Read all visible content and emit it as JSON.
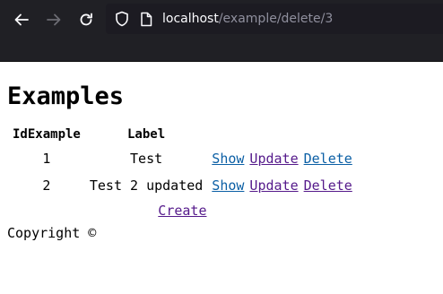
{
  "browser": {
    "url_host": "localhost",
    "url_path": "/example/delete/3",
    "icons": [
      "back-arrow-icon",
      "forward-arrow-icon",
      "reload-icon",
      "shield-icon",
      "page-icon"
    ]
  },
  "page": {
    "title": "Examples",
    "table": {
      "headers": [
        "IdExample",
        "Label"
      ],
      "rows": [
        {
          "id": "1",
          "label": "Test",
          "show": "Show",
          "update": "Update",
          "delete": "Delete"
        },
        {
          "id": "2",
          "label": "Test 2 updated",
          "show": "Show",
          "update": "Update",
          "delete": "Delete"
        }
      ],
      "create_label": "Create"
    },
    "footer": "Copyright ©"
  },
  "colors": {
    "chrome_bg": "#202025",
    "visited_link": "#551a8b",
    "link": "#0b5fa5"
  }
}
